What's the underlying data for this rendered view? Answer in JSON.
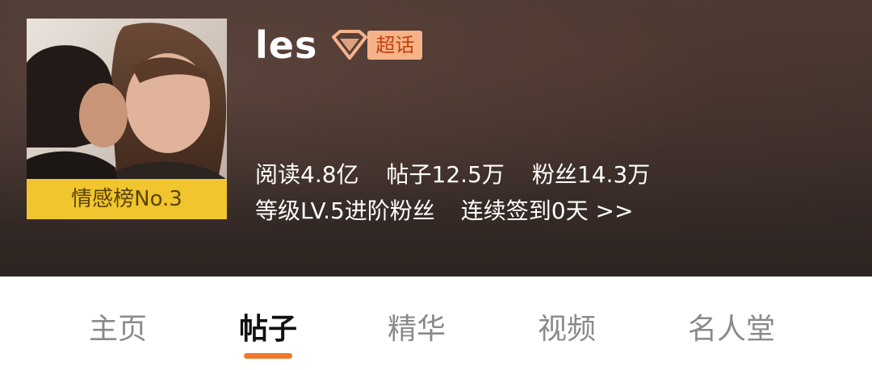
{
  "header": {
    "title": "les",
    "tag_label": "超话",
    "rank_badge": "情感榜No.3",
    "stats": {
      "reads": "阅读4.8亿",
      "posts": "帖子12.5万",
      "fans": "粉丝14.3万"
    },
    "level": "等级LV.5进阶粉丝",
    "checkin": "连续签到0天 >>"
  },
  "tabs": [
    {
      "label": "主页",
      "active": false
    },
    {
      "label": "帖子",
      "active": true
    },
    {
      "label": "精华",
      "active": false
    },
    {
      "label": "视频",
      "active": false
    },
    {
      "label": "名人堂",
      "active": false
    }
  ],
  "icons": {
    "tag_icon": "diamond-icon"
  },
  "colors": {
    "rank_badge_bg": "#f0c52e",
    "tag_bg": "#f6b38a",
    "tag_text": "#c2410c",
    "active_tab_underline": "#f07a2a"
  }
}
